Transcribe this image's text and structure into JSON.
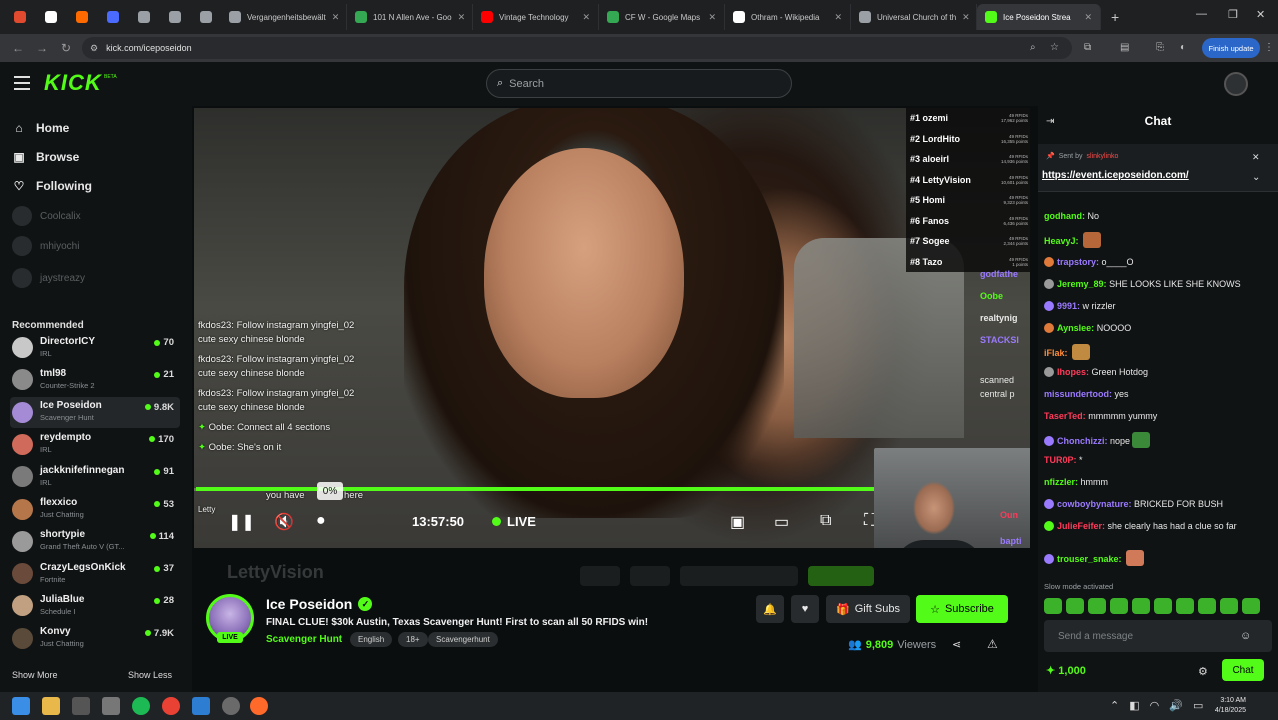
{
  "browser": {
    "tabs": [
      {
        "label": "",
        "color": "#e04a2f",
        "pinned": true
      },
      {
        "label": "",
        "color": "#ffffff",
        "pinned": true
      },
      {
        "label": "",
        "color": "#ff6a00",
        "pinned": true
      },
      {
        "label": "",
        "color": "#4b6bff",
        "pinned": true
      },
      {
        "label": "",
        "color": "#9aa0a6",
        "pinned": true
      },
      {
        "label": "",
        "color": "#9aa0a6",
        "pinned": true
      },
      {
        "label": "",
        "color": "#9aa0a6",
        "pinned": true
      },
      {
        "label": "Vergangenheitsbewält",
        "color": "#9aa0a6"
      },
      {
        "label": "101 N Allen Ave - Goo",
        "color": "#34a853"
      },
      {
        "label": "Vintage Technology",
        "color": "#ff0000"
      },
      {
        "label": "CF W - Google Maps",
        "color": "#34a853"
      },
      {
        "label": "Othram - Wikipedia",
        "color": "#ffffff"
      },
      {
        "label": "Universal Church of th",
        "color": "#9aa0a6"
      },
      {
        "label": "Ice Poseidon Strea",
        "color": "#53fc18",
        "active": true
      }
    ],
    "url": "kick.com/iceposeidon",
    "finish_update": "Finish update"
  },
  "header": {
    "logo": "KICK",
    "logo_badge": "BETA",
    "search_placeholder": "Search"
  },
  "sidebar": {
    "nav": [
      {
        "label": "Home",
        "icon": "home-icon"
      },
      {
        "label": "Browse",
        "icon": "browse-icon"
      },
      {
        "label": "Following",
        "icon": "heart-icon"
      }
    ],
    "following": [
      "Coolcalix",
      "mhiyochi",
      "jaystreazy"
    ],
    "recommended_title": "Recommended",
    "recommended": [
      {
        "name": "DirectorICY",
        "category": "IRL",
        "viewers": "70",
        "color": "#c8c8c8"
      },
      {
        "name": "tml98",
        "category": "Counter-Strike 2",
        "viewers": "21",
        "color": "#8a8a8a"
      },
      {
        "name": "Ice Poseidon",
        "category": "Scavenger Hunt",
        "viewers": "9.8K",
        "color": "#a58bd6",
        "active": true
      },
      {
        "name": "reydempto",
        "category": "IRL",
        "viewers": "170",
        "color": "#d06a5a"
      },
      {
        "name": "jackknifefinnegan",
        "category": "IRL",
        "viewers": "91",
        "color": "#7a7a7a"
      },
      {
        "name": "flexxico",
        "category": "Just Chatting",
        "viewers": "53",
        "color": "#b5764a"
      },
      {
        "name": "shortypie",
        "category": "Grand Theft Auto V (GT...",
        "viewers": "114",
        "color": "#9a9a9a"
      },
      {
        "name": "CrazyLegsOnKick",
        "category": "Fortnite",
        "viewers": "37",
        "color": "#6a4a3a"
      },
      {
        "name": "JuliaBlue",
        "category": "Schedule I",
        "viewers": "28",
        "color": "#c0a080"
      },
      {
        "name": "Konvy",
        "category": "Just Chatting",
        "viewers": "7.9K",
        "color": "#5a4a3a"
      }
    ],
    "show_more": "Show More",
    "show_less": "Show Less"
  },
  "video": {
    "leaderboard": [
      {
        "rank": "#1 ozemi",
        "pts1": "49 RFIDs",
        "pts2": "17,962 points"
      },
      {
        "rank": "#2 LordHito",
        "pts1": "49 RFIDs",
        "pts2": "16,355 points"
      },
      {
        "rank": "#3 aloeirl",
        "pts1": "49 RFIDs",
        "pts2": "14,936 points"
      },
      {
        "rank": "#4 LettyVision",
        "pts1": "49 RFIDs",
        "pts2": "10,601 points"
      },
      {
        "rank": "#5 Homi",
        "pts1": "49 RFIDs",
        "pts2": "9,323 points"
      },
      {
        "rank": "#6 Fanos",
        "pts1": "49 RFIDs",
        "pts2": "6,436 points"
      },
      {
        "rank": "#7 Sogee",
        "pts1": "49 RFIDs",
        "pts2": "2,344 points"
      },
      {
        "rank": "#8 Tazo",
        "pts1": "49 RFIDs",
        "pts2": "1 points"
      }
    ],
    "overlay_chat": [
      {
        "user": "fkdos23:",
        "text": "Follow instagram yingfei_02"
      },
      {
        "user": "",
        "text": "cute sexy chinese blonde"
      },
      {
        "user": "fkdos23:",
        "text": "Follow instagram yingfei_02"
      },
      {
        "user": "",
        "text": "cute sexy chinese blonde"
      },
      {
        "user": "fkdos23:",
        "text": "Follow instagram yingfei_02"
      },
      {
        "user": "",
        "text": "cute sexy chinese blonde"
      },
      {
        "user": "Oobe:",
        "text": "Connect all 4 sections"
      },
      {
        "user": "Oobe:",
        "text": "She's on it"
      }
    ],
    "overlay_partial": "you have",
    "overlay_partial2": "here",
    "overlay_letty": "Letty",
    "side_overlay": [
      "godfathe",
      "Oobe",
      "realtynig",
      "STACKSI",
      "",
      "scanned",
      "central p"
    ],
    "progress_percent": 0,
    "progress_label": "0%",
    "time": "13:57:50",
    "live": "LIVE",
    "cam_overlay": [
      "Oun",
      "bapti"
    ]
  },
  "stream": {
    "ghost_name": "LettyVision",
    "channel": "Ice Poseidon",
    "title": "FINAL CLUE! $30k Austin, Texas Scavenger Hunt! First to scan all 50 RFIDS win!",
    "category": "Scavenger Hunt",
    "tags": [
      "English",
      "18+",
      "Scavengerhunt"
    ],
    "live_badge": "LIVE",
    "gift_subs": "Gift Subs",
    "subscribe": "Subscribe",
    "viewers": "9,809",
    "viewers_label": "Viewers"
  },
  "chat": {
    "title": "Chat",
    "pinned_by_label": "Sent by",
    "pinned_by_user": "slinkylinko",
    "pinned_link": "https://event.iceposeidon.com/",
    "messages": [
      {
        "user": "godhand:",
        "text": "No",
        "color": "#53fc18"
      },
      {
        "user": "HeavyJ:",
        "text": "",
        "color": "#53fc18",
        "emote": "#b5673a"
      },
      {
        "user": "trapstory:",
        "text": "o____O",
        "color": "#9a7aff",
        "badge": "#e07a3a"
      },
      {
        "user": "Jeremy_89:",
        "text": "SHE LOOKS LIKE SHE KNOWS",
        "color": "#53fc18",
        "badge": "#9a9a9a"
      },
      {
        "user": "9991:",
        "text": "w rizzler",
        "color": "#9a7aff",
        "badge": "#9a7aff"
      },
      {
        "user": "Aynslee:",
        "text": "NOOOO",
        "color": "#53fc18",
        "badge": "#e07a3a"
      },
      {
        "user": "iFlak:",
        "text": "",
        "color": "#ff8c3a",
        "emote": "#c08a40"
      },
      {
        "user": "Ihopes:",
        "text": "Green Hotdog",
        "color": "#ff3a5a",
        "badge": "#9a9a9a"
      },
      {
        "user": "missundertood:",
        "text": "yes",
        "color": "#9a7aff"
      },
      {
        "user": "TaserTed:",
        "text": "mmmmm yummy",
        "color": "#ff3a5a"
      },
      {
        "user": "Chonchizzi:",
        "text": "nope",
        "color": "#9a7aff",
        "badge": "#9a7aff",
        "emote": "#3a8a3a"
      },
      {
        "user": "TUR0P:",
        "text": "*",
        "color": "#ff3a5a"
      },
      {
        "user": "nfizzler:",
        "text": "hmmm",
        "color": "#53fc18"
      },
      {
        "user": "cowboybynature:",
        "text": "BRICKED FOR BUSH",
        "color": "#9a7aff",
        "badge": "#9a7aff"
      },
      {
        "user": "JulieFeifer:",
        "text": "she clearly has had a clue so far",
        "color": "#ff3a5a",
        "badge": "#53fc18"
      },
      {
        "user": "trouser_snake:",
        "text": "",
        "color": "#53fc18",
        "badge": "#9a7aff",
        "emote": "#d07a5a"
      }
    ],
    "slow_mode": "Slow mode activated",
    "input_placeholder": "Send a message",
    "points": "1,000",
    "send": "Chat"
  },
  "taskbar": {
    "time": "3:10 AM",
    "date": "4/18/2025"
  }
}
